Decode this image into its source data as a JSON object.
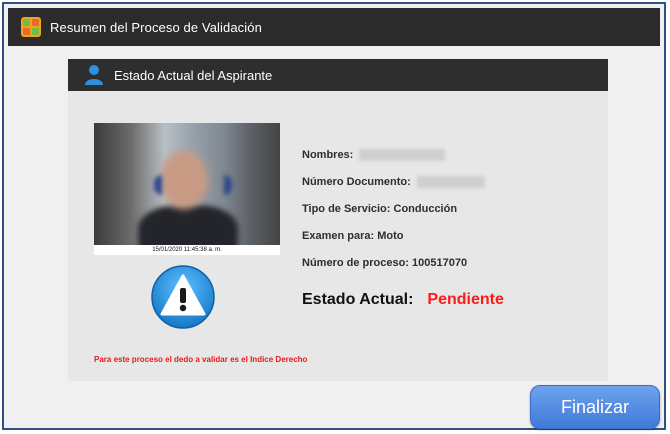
{
  "window": {
    "title": "Resumen del Proceso de Validación",
    "app_icon": "app-puzzle-icon"
  },
  "panel": {
    "header": "Estado Actual del Aspirante",
    "header_icon": "user-icon",
    "photo_timestamp": "15/01/2020 11:45:38 a. m.",
    "fields": [
      {
        "label": "Nombres:",
        "value": ""
      },
      {
        "label": "Número Documento:",
        "value": ""
      },
      {
        "label": "Tipo de Servicio:",
        "value": "Conducción"
      },
      {
        "label": "Examen para:",
        "value": "Moto"
      },
      {
        "label": "Número de proceso:",
        "value": "100517070"
      }
    ],
    "estado_label": "Estado Actual:",
    "estado_value": "Pendiente",
    "warning_icon": "warning-icon",
    "note": "Para este proceso el dedo a validar es el Indice Derecho"
  },
  "footer": {
    "finalizar_label": "Finalizar"
  },
  "colors": {
    "status_pending": "#ff1a1a",
    "note": "#e41b1b",
    "button": "#4a85e0",
    "titlebar": "#2b2b2b"
  }
}
